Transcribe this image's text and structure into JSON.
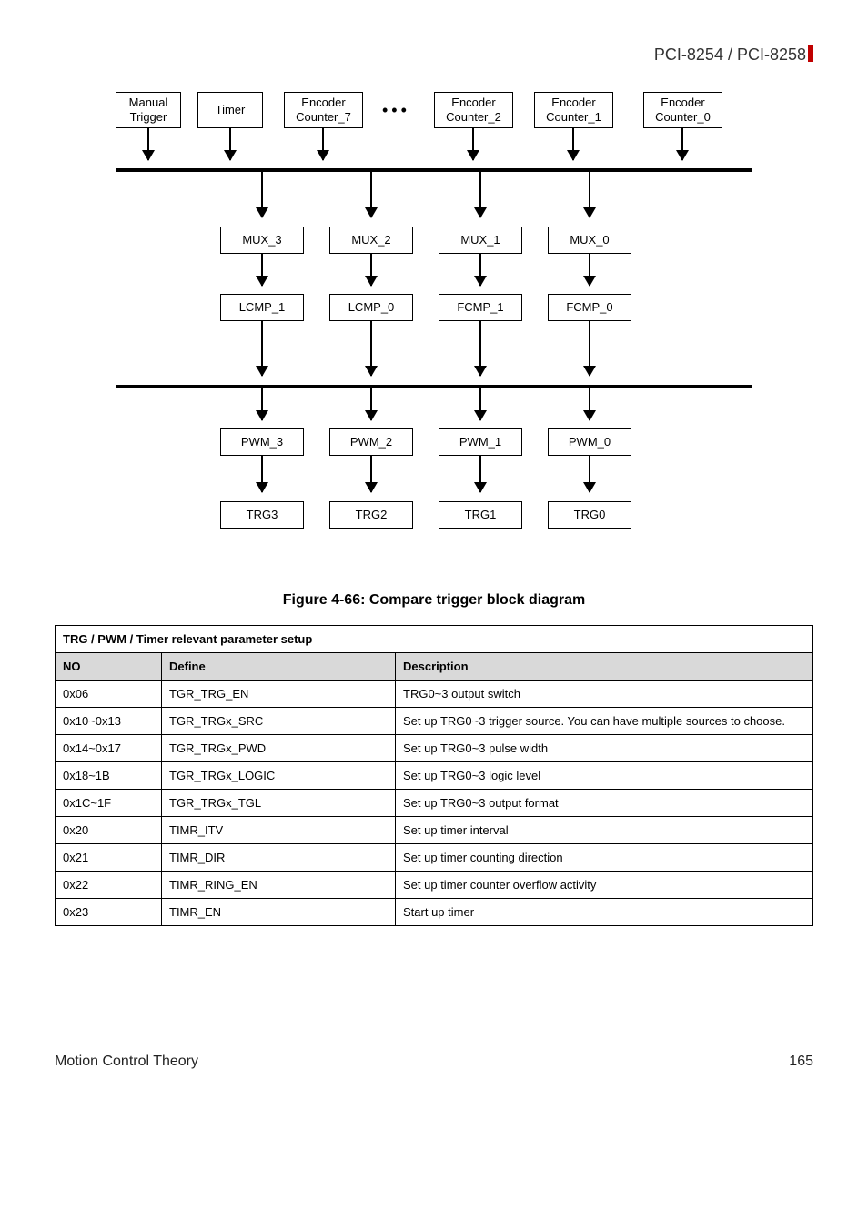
{
  "header": "PCI-8254 / PCI-8258",
  "diagram": {
    "row1": {
      "manual_trigger_l1": "Manual",
      "manual_trigger_l2": "Trigger",
      "timer": "Timer",
      "enc7_l1": "Encoder",
      "enc7_l2": "Counter_7",
      "enc2_l1": "Encoder",
      "enc2_l2": "Counter_2",
      "enc1_l1": "Encoder",
      "enc1_l2": "Counter_1",
      "enc0_l1": "Encoder",
      "enc0_l2": "Counter_0"
    },
    "row2": {
      "mux3": "MUX_3",
      "mux2": "MUX_2",
      "mux1": "MUX_1",
      "mux0": "MUX_0"
    },
    "row3": {
      "lcmp1": "LCMP_1",
      "lcmp0": "LCMP_0",
      "fcmp1": "FCMP_1",
      "fcmp0": "FCMP_0"
    },
    "row4": {
      "pwm3": "PWM_3",
      "pwm2": "PWM_2",
      "pwm1": "PWM_1",
      "pwm0": "PWM_0"
    },
    "row5": {
      "trg3": "TRG3",
      "trg2": "TRG2",
      "trg1": "TRG1",
      "trg0": "TRG0"
    }
  },
  "figure_caption": "Figure 4-66: Compare trigger block diagram",
  "table": {
    "title": "TRG / PWM / Timer relevant parameter setup",
    "headers": {
      "no": "NO",
      "define": "Define",
      "description": "Description"
    },
    "rows": [
      {
        "no": "0x06",
        "define": "TGR_TRG_EN",
        "desc": "TRG0~3 output switch"
      },
      {
        "no": "0x10~0x13",
        "define": "TGR_TRGx_SRC",
        "desc": "Set up TRG0~3 trigger source. You can have multiple sources to choose."
      },
      {
        "no": "0x14~0x17",
        "define": "TGR_TRGx_PWD",
        "desc": "Set up TRG0~3 pulse width"
      },
      {
        "no": "0x18~1B",
        "define": "TGR_TRGx_LOGIC",
        "desc": "Set up TRG0~3 logic level"
      },
      {
        "no": "0x1C~1F",
        "define": "TGR_TRGx_TGL",
        "desc": "Set up TRG0~3 output format"
      },
      {
        "no": "0x20",
        "define": "TIMR_ITV",
        "desc": "Set up timer interval"
      },
      {
        "no": "0x21",
        "define": "TIMR_DIR",
        "desc": "Set up timer counting direction"
      },
      {
        "no": "0x22",
        "define": "TIMR_RING_EN",
        "desc": "Set up timer counter overflow activity"
      },
      {
        "no": "0x23",
        "define": "TIMR_EN",
        "desc": "Start up timer"
      }
    ]
  },
  "footer": {
    "left": "Motion Control Theory",
    "right": "165"
  }
}
